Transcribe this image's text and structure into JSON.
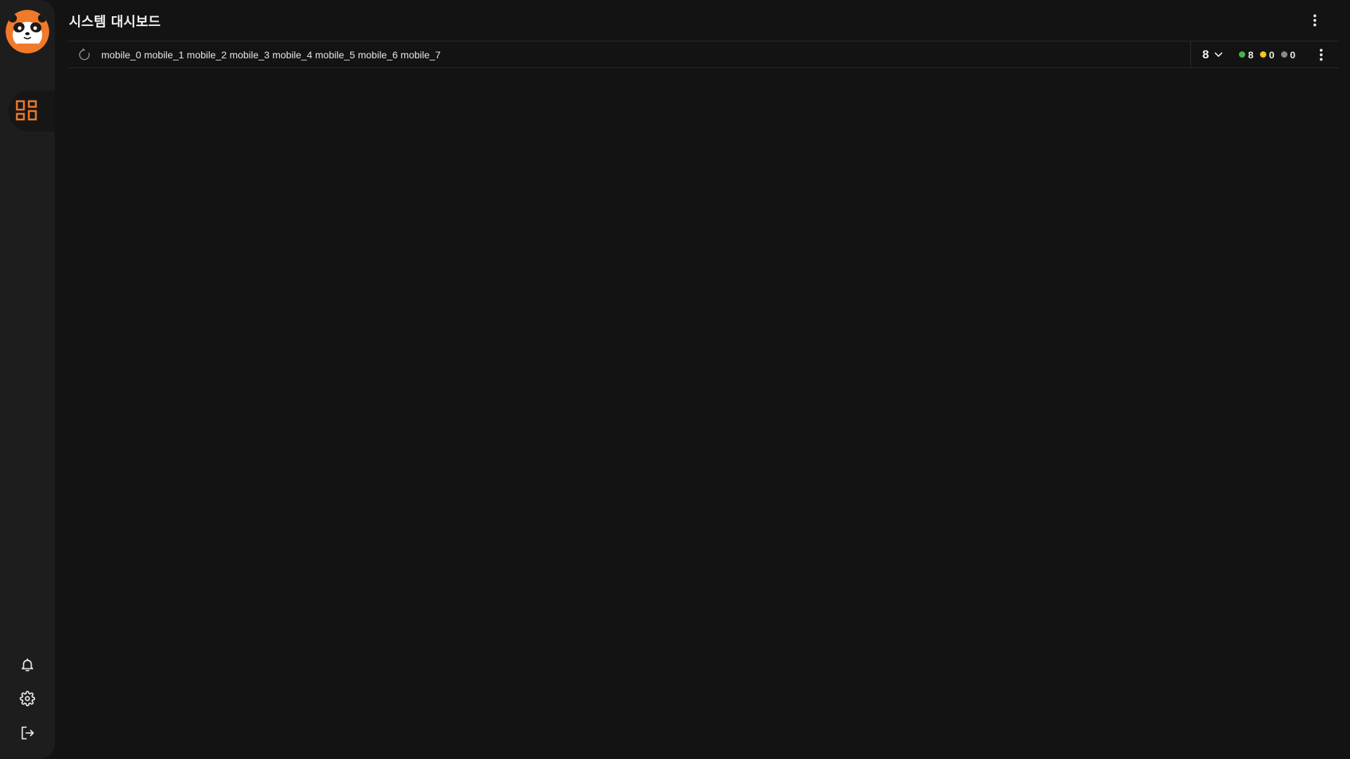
{
  "app": {
    "brand_color": "#f07a2a",
    "background": "#131313",
    "sidebar_background": "#1d1d1d"
  },
  "sidebar": {
    "logo": "panda-mascot-logo",
    "items": [
      {
        "name": "dashboard",
        "icon": "dashboard-grid-icon",
        "active": true
      }
    ],
    "bottom_items": [
      {
        "name": "notifications",
        "icon": "bell-icon"
      },
      {
        "name": "settings",
        "icon": "gear-icon"
      },
      {
        "name": "logout",
        "icon": "logout-icon"
      }
    ]
  },
  "header": {
    "title": "시스템 대시보드",
    "menu_icon": "more-vertical-icon"
  },
  "group": {
    "refresh_icon": "refresh-icon",
    "devices": [
      "mobile_0",
      "mobile_1",
      "mobile_2",
      "mobile_3",
      "mobile_4",
      "mobile_5",
      "mobile_6",
      "mobile_7"
    ],
    "count": "8",
    "count_icon": "chevron-down-icon",
    "status": {
      "online": {
        "count": "8",
        "color": "#4caf50"
      },
      "busy": {
        "count": "0",
        "color": "#f5c518"
      },
      "offline": {
        "count": "0",
        "color": "#8a8a8a"
      }
    },
    "menu_icon": "more-vertical-icon"
  }
}
